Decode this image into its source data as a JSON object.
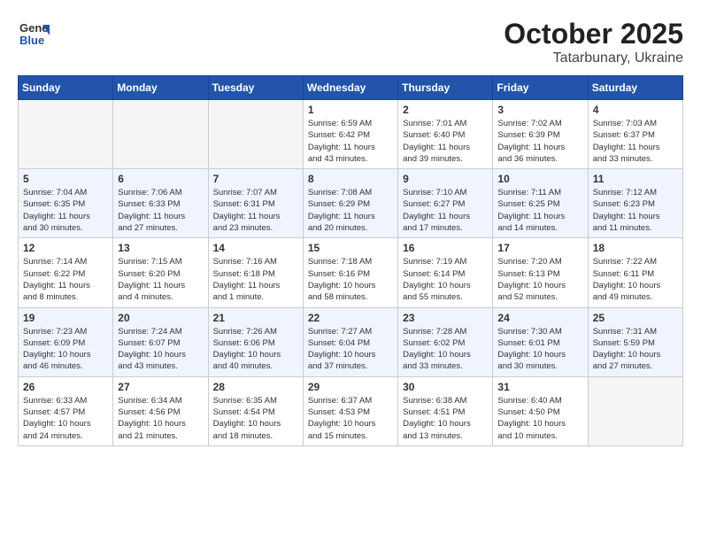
{
  "header": {
    "logo_general": "General",
    "logo_blue": "Blue",
    "month": "October 2025",
    "location": "Tatarbunary, Ukraine"
  },
  "weekdays": [
    "Sunday",
    "Monday",
    "Tuesday",
    "Wednesday",
    "Thursday",
    "Friday",
    "Saturday"
  ],
  "weeks": [
    [
      {
        "day": "",
        "info": ""
      },
      {
        "day": "",
        "info": ""
      },
      {
        "day": "",
        "info": ""
      },
      {
        "day": "1",
        "info": "Sunrise: 6:59 AM\nSunset: 6:42 PM\nDaylight: 11 hours\nand 43 minutes."
      },
      {
        "day": "2",
        "info": "Sunrise: 7:01 AM\nSunset: 6:40 PM\nDaylight: 11 hours\nand 39 minutes."
      },
      {
        "day": "3",
        "info": "Sunrise: 7:02 AM\nSunset: 6:39 PM\nDaylight: 11 hours\nand 36 minutes."
      },
      {
        "day": "4",
        "info": "Sunrise: 7:03 AM\nSunset: 6:37 PM\nDaylight: 11 hours\nand 33 minutes."
      }
    ],
    [
      {
        "day": "5",
        "info": "Sunrise: 7:04 AM\nSunset: 6:35 PM\nDaylight: 11 hours\nand 30 minutes."
      },
      {
        "day": "6",
        "info": "Sunrise: 7:06 AM\nSunset: 6:33 PM\nDaylight: 11 hours\nand 27 minutes."
      },
      {
        "day": "7",
        "info": "Sunrise: 7:07 AM\nSunset: 6:31 PM\nDaylight: 11 hours\nand 23 minutes."
      },
      {
        "day": "8",
        "info": "Sunrise: 7:08 AM\nSunset: 6:29 PM\nDaylight: 11 hours\nand 20 minutes."
      },
      {
        "day": "9",
        "info": "Sunrise: 7:10 AM\nSunset: 6:27 PM\nDaylight: 11 hours\nand 17 minutes."
      },
      {
        "day": "10",
        "info": "Sunrise: 7:11 AM\nSunset: 6:25 PM\nDaylight: 11 hours\nand 14 minutes."
      },
      {
        "day": "11",
        "info": "Sunrise: 7:12 AM\nSunset: 6:23 PM\nDaylight: 11 hours\nand 11 minutes."
      }
    ],
    [
      {
        "day": "12",
        "info": "Sunrise: 7:14 AM\nSunset: 6:22 PM\nDaylight: 11 hours\nand 8 minutes."
      },
      {
        "day": "13",
        "info": "Sunrise: 7:15 AM\nSunset: 6:20 PM\nDaylight: 11 hours\nand 4 minutes."
      },
      {
        "day": "14",
        "info": "Sunrise: 7:16 AM\nSunset: 6:18 PM\nDaylight: 11 hours\nand 1 minute."
      },
      {
        "day": "15",
        "info": "Sunrise: 7:18 AM\nSunset: 6:16 PM\nDaylight: 10 hours\nand 58 minutes."
      },
      {
        "day": "16",
        "info": "Sunrise: 7:19 AM\nSunset: 6:14 PM\nDaylight: 10 hours\nand 55 minutes."
      },
      {
        "day": "17",
        "info": "Sunrise: 7:20 AM\nSunset: 6:13 PM\nDaylight: 10 hours\nand 52 minutes."
      },
      {
        "day": "18",
        "info": "Sunrise: 7:22 AM\nSunset: 6:11 PM\nDaylight: 10 hours\nand 49 minutes."
      }
    ],
    [
      {
        "day": "19",
        "info": "Sunrise: 7:23 AM\nSunset: 6:09 PM\nDaylight: 10 hours\nand 46 minutes."
      },
      {
        "day": "20",
        "info": "Sunrise: 7:24 AM\nSunset: 6:07 PM\nDaylight: 10 hours\nand 43 minutes."
      },
      {
        "day": "21",
        "info": "Sunrise: 7:26 AM\nSunset: 6:06 PM\nDaylight: 10 hours\nand 40 minutes."
      },
      {
        "day": "22",
        "info": "Sunrise: 7:27 AM\nSunset: 6:04 PM\nDaylight: 10 hours\nand 37 minutes."
      },
      {
        "day": "23",
        "info": "Sunrise: 7:28 AM\nSunset: 6:02 PM\nDaylight: 10 hours\nand 33 minutes."
      },
      {
        "day": "24",
        "info": "Sunrise: 7:30 AM\nSunset: 6:01 PM\nDaylight: 10 hours\nand 30 minutes."
      },
      {
        "day": "25",
        "info": "Sunrise: 7:31 AM\nSunset: 5:59 PM\nDaylight: 10 hours\nand 27 minutes."
      }
    ],
    [
      {
        "day": "26",
        "info": "Sunrise: 6:33 AM\nSunset: 4:57 PM\nDaylight: 10 hours\nand 24 minutes."
      },
      {
        "day": "27",
        "info": "Sunrise: 6:34 AM\nSunset: 4:56 PM\nDaylight: 10 hours\nand 21 minutes."
      },
      {
        "day": "28",
        "info": "Sunrise: 6:35 AM\nSunset: 4:54 PM\nDaylight: 10 hours\nand 18 minutes."
      },
      {
        "day": "29",
        "info": "Sunrise: 6:37 AM\nSunset: 4:53 PM\nDaylight: 10 hours\nand 15 minutes."
      },
      {
        "day": "30",
        "info": "Sunrise: 6:38 AM\nSunset: 4:51 PM\nDaylight: 10 hours\nand 13 minutes."
      },
      {
        "day": "31",
        "info": "Sunrise: 6:40 AM\nSunset: 4:50 PM\nDaylight: 10 hours\nand 10 minutes."
      },
      {
        "day": "",
        "info": ""
      }
    ]
  ]
}
